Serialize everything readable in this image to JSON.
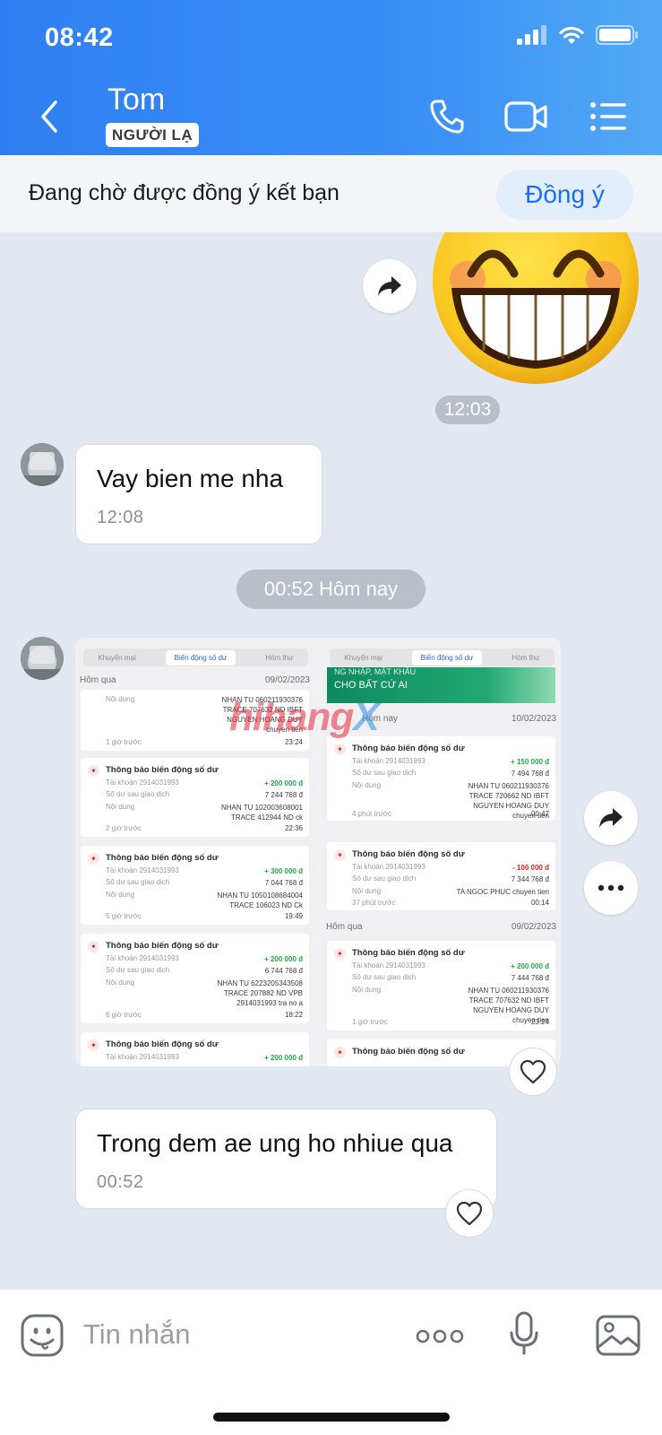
{
  "status_bar": {
    "time": "08:42",
    "icons": [
      "signal-icon",
      "wifi-icon",
      "battery-icon"
    ]
  },
  "header": {
    "contact_name": "Tom",
    "badge": "NGƯỜI LẠ",
    "icons": [
      "back-icon",
      "phone-icon",
      "video-call-icon",
      "menu-icon"
    ]
  },
  "friend_request": {
    "text": "Đang chờ được đồng ý kết bạn",
    "accept_label": "Đồng ý"
  },
  "messages": {
    "sticker": {
      "name": "grinning-face-sticker",
      "time": "12:03"
    },
    "msg1": {
      "text": "Vay bien me nha",
      "time": "12:08"
    },
    "date_separator": "00:52 Hôm nay",
    "msg2": {
      "text": "Trong dem ae ung ho nhiue qua",
      "time": "00:52"
    }
  },
  "screenshot_image": {
    "watermark": {
      "part1": "hihang",
      "part2": "X"
    },
    "left": {
      "tabs": [
        "Khuyến mại",
        "Biến động số dư",
        "Hòm thư"
      ],
      "group1": {
        "label": "Hôm qua",
        "date": "09/02/2023"
      },
      "top_partial": {
        "content_label": "Nội dung",
        "content_lines": [
          "NHAN TU 060211930376",
          "TRACE 707632 ND IBFT",
          "NGUYEN HOANG DUY",
          "chuyen tien"
        ],
        "ago": "1 giờ trước",
        "clock": "23:24"
      },
      "cards": [
        {
          "title": "Thông báo biến động số dư",
          "account_label": "Tài khoản 2914031993",
          "amount": "+ 200 000 đ",
          "balance_label": "Số dư sau giao dịch",
          "balance": "7 244 768 đ",
          "content_label": "Nội dung",
          "content_lines": [
            "NHAN TU 102003608001",
            "TRACE 412944 ND ck"
          ],
          "ago": "2 giờ trước",
          "clock": "22:36"
        },
        {
          "title": "Thông báo biến động số dư",
          "account_label": "Tài khoản 2914031993",
          "amount": "+ 300 000 đ",
          "balance_label": "Số dư sau giao dịch",
          "balance": "7 044 768 đ",
          "content_label": "Nội dung",
          "content_lines": [
            "NHAN TU 1050108684004",
            "TRACE 106023 ND Ck"
          ],
          "ago": "5 giờ trước",
          "clock": "19:49"
        },
        {
          "title": "Thông báo biến động số dư",
          "account_label": "Tài khoản 2914031993",
          "amount": "+ 200 000 đ",
          "balance_label": "Số dư sau giao dịch",
          "balance": "6 744 768 đ",
          "content_label": "Nội dung",
          "content_lines": [
            "NHAN TU 6223205343508",
            "TRACE 207882 ND VPB",
            "2914031993 tra no a"
          ],
          "ago": "6 giờ trước",
          "clock": "18:22"
        }
      ],
      "bottom_partial": {
        "title": "Thông báo biến động số dư",
        "account_label": "Tài khoản 2914031993",
        "amount": "+ 200 000 đ"
      }
    },
    "right": {
      "tabs": [
        "Khuyến mại",
        "Biến động số dư",
        "Hòm thư"
      ],
      "banner": "CHO BẤT CỨ AI",
      "banner_top": "NG NHẬP, MẬT KHẨU",
      "group1": {
        "label": "Hôm nay",
        "date": "10/02/2023"
      },
      "cards_today": [
        {
          "title": "Thông báo biến động số dư",
          "account_label": "Tài khoản 2914031993",
          "amount": "+ 150 000 đ",
          "balance_label": "Số dư sau giao dịch",
          "balance": "7 494 768 đ",
          "content_label": "Nội dung",
          "content_lines": [
            "NHAN TU 060211930376",
            "TRACE 720662 ND IBFT",
            "NGUYEN HOANG DUY",
            "chuyen tien"
          ],
          "ago": "4 phút trước",
          "clock": "00:47"
        },
        {
          "title": "Thông báo biến động số dư",
          "account_label": "Tài khoản 2914031993",
          "amount": "- 100 000 đ",
          "balance_label": "Số dư sau giao dịch",
          "balance": "7 344 768 đ",
          "content_label": "Nội dung",
          "content_lines": [
            "TA NGOC PHUC chuyen tien"
          ],
          "ago": "37 phút trước",
          "clock": "00:14"
        }
      ],
      "group2": {
        "label": "Hôm qua",
        "date": "09/02/2023"
      },
      "cards_yesterday": [
        {
          "title": "Thông báo biến động số dư",
          "account_label": "Tài khoản 2914031993",
          "amount": "+ 200 000 đ",
          "balance_label": "Số dư sau giao dịch",
          "balance": "7 444 768 đ",
          "content_label": "Nội dung",
          "content_lines": [
            "NHAN TU 060211930376",
            "TRACE 707632 ND IBFT",
            "NGUYEN HOANG DUY",
            "chuyen tien"
          ],
          "ago": "1 giờ trước",
          "clock": "23:24"
        }
      ],
      "bottom_partial_title": "Thông báo biến động số dư"
    }
  },
  "input_bar": {
    "placeholder": "Tin nhắn",
    "icons": [
      "sticker-icon",
      "more-icon",
      "microphone-icon",
      "image-icon"
    ]
  }
}
